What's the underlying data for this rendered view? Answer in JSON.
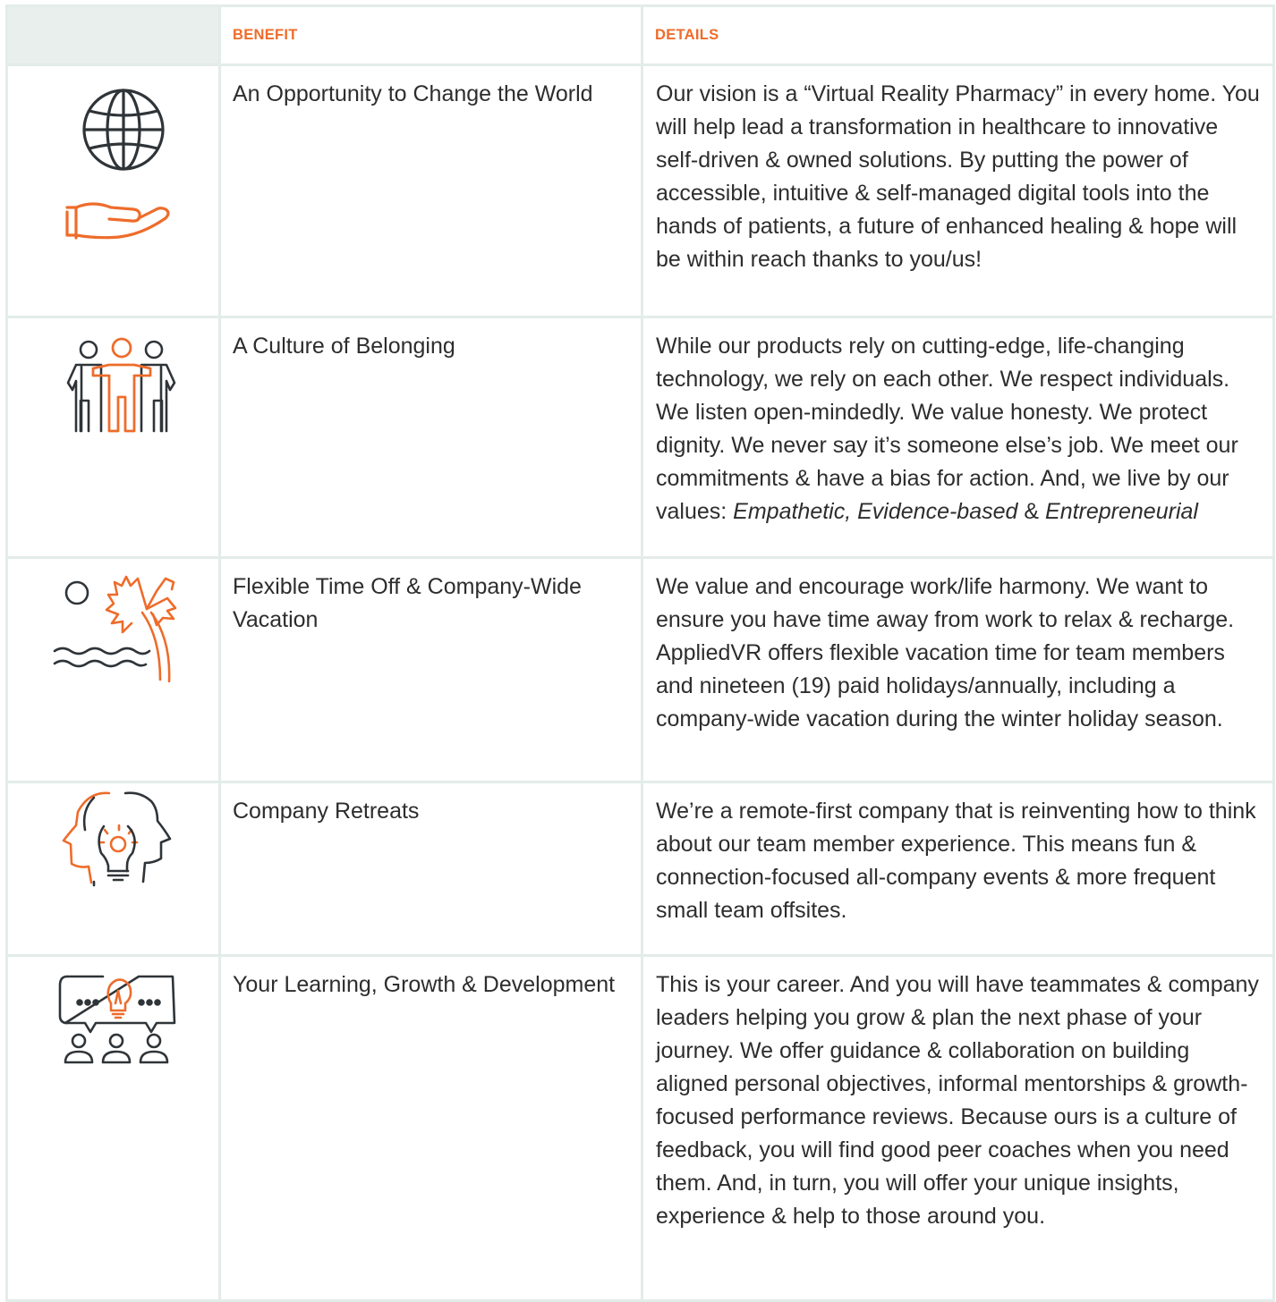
{
  "header": {
    "benefit_label": "BENEFIT",
    "details_label": "DETAILS"
  },
  "colors": {
    "accent": "#EE6C2B",
    "text": "#2D2D2D",
    "border": "#E3ECE9",
    "header_icon_bg": "#E8EFED"
  },
  "rows": [
    {
      "icon": "globe-hand-icon",
      "benefit": "An Opportunity to Change the World",
      "details": "Our vision is a “Virtual Reality Pharmacy” in every home. You will help lead a transformation in healthcare to innovative self-driven & owned solutions. By putting the power of accessible, intuitive & self-managed digital tools into the hands of patients, a future of enhanced healing & hope will be within reach thanks to you/us!"
    },
    {
      "icon": "team-people-icon",
      "benefit": "A Culture of Belonging",
      "details_lead": "While our products rely on cutting-edge, life-changing technology, we rely on each other. We respect individuals. We listen open-mindedly. We value honesty. We protect dignity. We never say it’s someone else’s job. We meet our commitments & have a bias for action. And, we live by our values:",
      "value_1": "Empathetic, Evidence-based",
      "values_joiner": "&",
      "value_2": "Entrepreneurial"
    },
    {
      "icon": "beach-palm-icon",
      "benefit": "Flexible Time Off & Company-Wide Vacation",
      "details": "We value and encourage work/life harmony. We want to ensure you have time away from work to relax & recharge. AppliedVR offers flexible vacation time for team members and nineteen (19) paid holidays/annually, including a company-wide vacation during the winter holiday season."
    },
    {
      "icon": "heads-lightbulb-icon",
      "benefit": "Company Retreats",
      "details": "We’re a remote-first company that is reinventing how to think about our team member experience. This means fun & connection-focused all-company events & more frequent small team offsites."
    },
    {
      "icon": "speech-bubble-team-icon",
      "benefit": "Your Learning, Growth & Development",
      "details": "This is your career. And you will have teammates & company leaders helping you grow & plan the next phase of your journey. We offer guidance & collaboration on building aligned personal objectives, informal mentorships & growth-focused performance reviews. Because ours is a culture of feedback, you will find good peer coaches when you need them. And, in turn, you will offer your unique insights, experience & help to those around you."
    }
  ]
}
